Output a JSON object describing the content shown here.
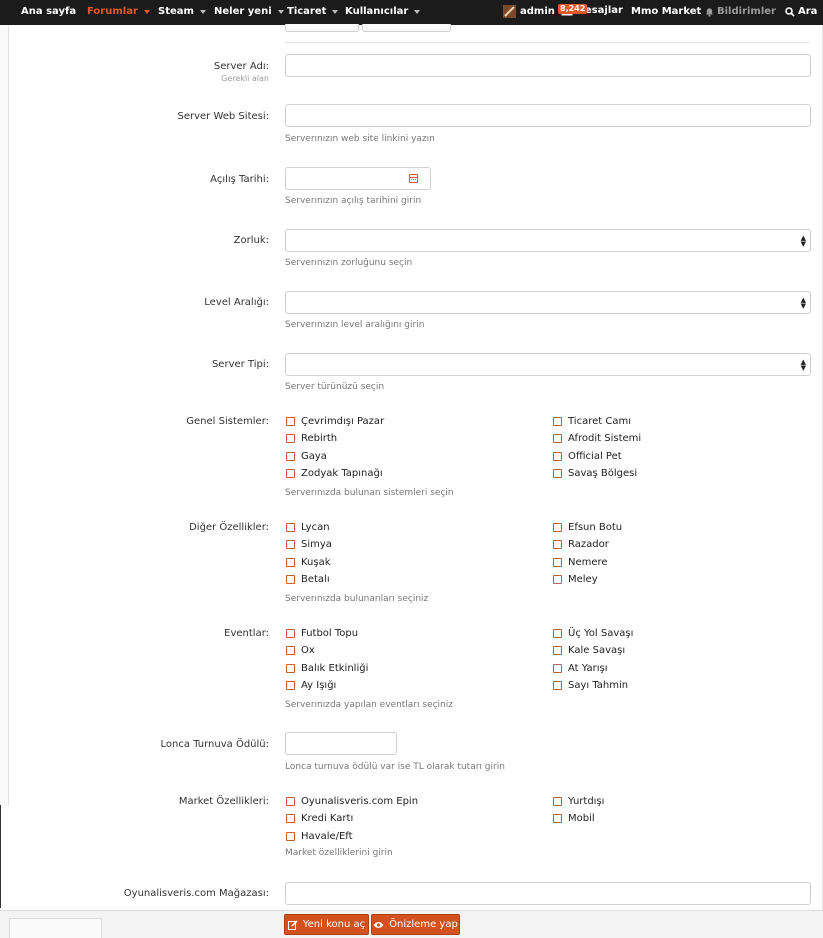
{
  "nav": {
    "home": "Ana sayfa",
    "forums": "Forumlar",
    "steam": "Steam",
    "whats_new": "Neler yeni",
    "trade": "Ticaret",
    "users": "Kullanıcılar",
    "user": "admin",
    "messages_count": "8,242",
    "messages": "Mesajlar",
    "market": "Mmo Market",
    "notifications": "Bildirimler",
    "search": "Ara"
  },
  "form": {
    "server_name": {
      "label": "Server Adı:",
      "required": "Gerekli alan",
      "value": ""
    },
    "website": {
      "label": "Server Web Sitesi:",
      "hint": "Serverınızın web site linkini yazın",
      "value": ""
    },
    "open_date": {
      "label": "Açılış Tarihi:",
      "hint": "Serverınızın açılış tarihini girin",
      "value": ""
    },
    "difficulty": {
      "label": "Zorluk:",
      "hint": "Serverınızın zorluğunu seçin",
      "selected": ""
    },
    "level_range": {
      "label": "Level Aralığı:",
      "hint": "Serverınızın level aralığını girin",
      "selected": ""
    },
    "server_type": {
      "label": "Server Tipi:",
      "hint": "Server türünüzü seçin",
      "selected": ""
    },
    "general_systems": {
      "label": "Genel Sistemler:",
      "hint": "Serverınızda bulunan sistemleri seçin",
      "col1": [
        "Çevrimdışı Pazar",
        "Rebirth",
        "Gaya",
        "Zodyak Tapınağı"
      ],
      "col2": [
        "Ticaret Camı",
        "Afrodit Sistemi",
        "Official Pet",
        "Savaş Bölgesi"
      ]
    },
    "other_features": {
      "label": "Diğer Özellikler:",
      "hint": "Serverınızda bulunanları seçiniz",
      "col1": [
        "Lycan",
        "Simya",
        "Kuşak",
        "Betalı"
      ],
      "col2": [
        "Efsun Botu",
        "Razador",
        "Nemere",
        "Meley"
      ]
    },
    "events": {
      "label": "Eventlar:",
      "hint": "Serverınızda yapılan eventları seçiniz",
      "col1": [
        "Futbol Topu",
        "Ox",
        "Balık Etkinliği",
        "Ay Işığı"
      ],
      "col2": [
        "Üç Yol Savaşı",
        "Kale Savaşı",
        "At Yarışı",
        "Sayı Tahmin"
      ]
    },
    "guild_prize": {
      "label": "Lonca Turnuva Ödülü:",
      "hint": "Lonca turnuva ödülü var ise TL olarak tutarı girin",
      "value": ""
    },
    "market_features": {
      "label": "Market Özellikleri:",
      "hint": "Market özelliklerini girin",
      "col1": [
        "Oyunalisveris.com Epin",
        "Kredi Kartı",
        "Havale/Eft"
      ],
      "col2": [
        "Yurtdışı",
        "Mobil"
      ]
    },
    "store": {
      "label": "Oyunalisveris.com Mağazası:",
      "value": ""
    }
  },
  "actions": {
    "create_thread": "Yeni konu aç",
    "preview": "Önizleme yap"
  },
  "colors": {
    "accent": "#e0592a",
    "button": "#d2511f",
    "nav_bg": "#1b1b1b"
  }
}
